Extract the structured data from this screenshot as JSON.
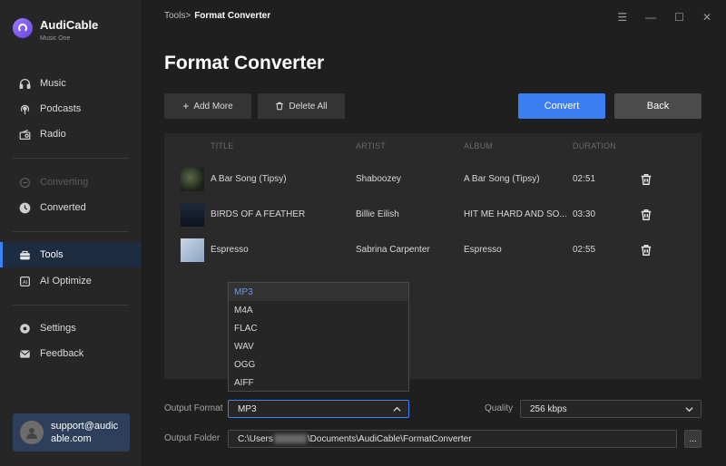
{
  "app": {
    "name": "AudiCable",
    "subtitle": "Music One"
  },
  "sidebar": {
    "items": [
      {
        "label": "Music",
        "icon": "headphones-icon",
        "state": "normal"
      },
      {
        "label": "Podcasts",
        "icon": "podcast-icon",
        "state": "normal"
      },
      {
        "label": "Radio",
        "icon": "radio-icon",
        "state": "normal"
      },
      {
        "label": "Converting",
        "icon": "converting-icon",
        "state": "disabled"
      },
      {
        "label": "Converted",
        "icon": "clock-icon",
        "state": "normal"
      },
      {
        "label": "Tools",
        "icon": "toolbox-icon",
        "state": "active"
      },
      {
        "label": "AI Optimize",
        "icon": "ai-icon",
        "state": "normal"
      },
      {
        "label": "Settings",
        "icon": "gear-icon",
        "state": "normal"
      },
      {
        "label": "Feedback",
        "icon": "mail-icon",
        "state": "normal"
      }
    ],
    "user_email": "support@audicable.com"
  },
  "header": {
    "breadcrumb_parent": "Tools",
    "breadcrumb_sep": ">",
    "breadcrumb_current": "Format Converter",
    "title": "Format Converter"
  },
  "toolbar": {
    "add_more": "Add More",
    "delete_all": "Delete All",
    "convert": "Convert",
    "back": "Back"
  },
  "table": {
    "columns": [
      "TITLE",
      "ARTIST",
      "ALBUM",
      "DURATION"
    ],
    "rows": [
      {
        "title": "A Bar Song (Tipsy)",
        "artist": "Shaboozey",
        "album": "A Bar Song (Tipsy)",
        "duration": "02:51"
      },
      {
        "title": "BIRDS OF A FEATHER",
        "artist": "Billie Eilish",
        "album": "HIT ME HARD AND SO...",
        "duration": "03:30"
      },
      {
        "title": "Espresso",
        "artist": "Sabrina Carpenter",
        "album": "Espresso",
        "duration": "02:55"
      }
    ]
  },
  "output": {
    "format_label": "Output Format",
    "format_value": "MP3",
    "format_options": [
      "MP3",
      "M4A",
      "FLAC",
      "WAV",
      "OGG",
      "AIFF"
    ],
    "quality_label": "Quality",
    "quality_value": "256 kbps",
    "folder_label": "Output Folder",
    "folder_prefix": "C:\\Users",
    "folder_suffix": "\\Documents\\AudiCable\\FormatConverter",
    "browse_label": "..."
  },
  "colors": {
    "accent": "#3a7ef2",
    "active_nav_bg": "#1d2c40",
    "selected_option": "#5b9bff"
  }
}
